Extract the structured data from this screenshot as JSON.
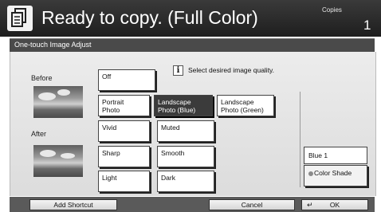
{
  "header": {
    "title": "Ready to copy. (Full Color)",
    "copies_label": "Copies",
    "copies_value": "1",
    "icon": "copier-icon"
  },
  "panel": {
    "title": "One-touch Image Adjust",
    "before_label": "Before",
    "after_label": "After",
    "info_icon_glyph": "i",
    "instruction": "Select desired image quality."
  },
  "options": [
    {
      "label": "Off",
      "selected": false
    },
    {
      "label": "Portrait\nPhoto",
      "selected": false
    },
    {
      "label": "Landscape\nPhoto (Blue)",
      "selected": true
    },
    {
      "label": "Landscape\nPhoto (Green)",
      "selected": false
    },
    {
      "label": "Vivid",
      "selected": false
    },
    {
      "label": "Muted",
      "selected": false
    },
    {
      "label": "Sharp",
      "selected": false
    },
    {
      "label": "Smooth",
      "selected": false
    },
    {
      "label": "Light",
      "selected": false
    },
    {
      "label": "Dark",
      "selected": false
    }
  ],
  "color_shade": {
    "value": "Blue 1",
    "button_label": "Color Shade"
  },
  "footer": {
    "add_shortcut": "Add Shortcut",
    "cancel": "Cancel",
    "ok": "OK",
    "enter_glyph": "↵"
  },
  "colors": {
    "header_bg": "#2a2a2a",
    "selected_bg": "#3b3b3b",
    "panel_bg": "#e4e4e4"
  }
}
